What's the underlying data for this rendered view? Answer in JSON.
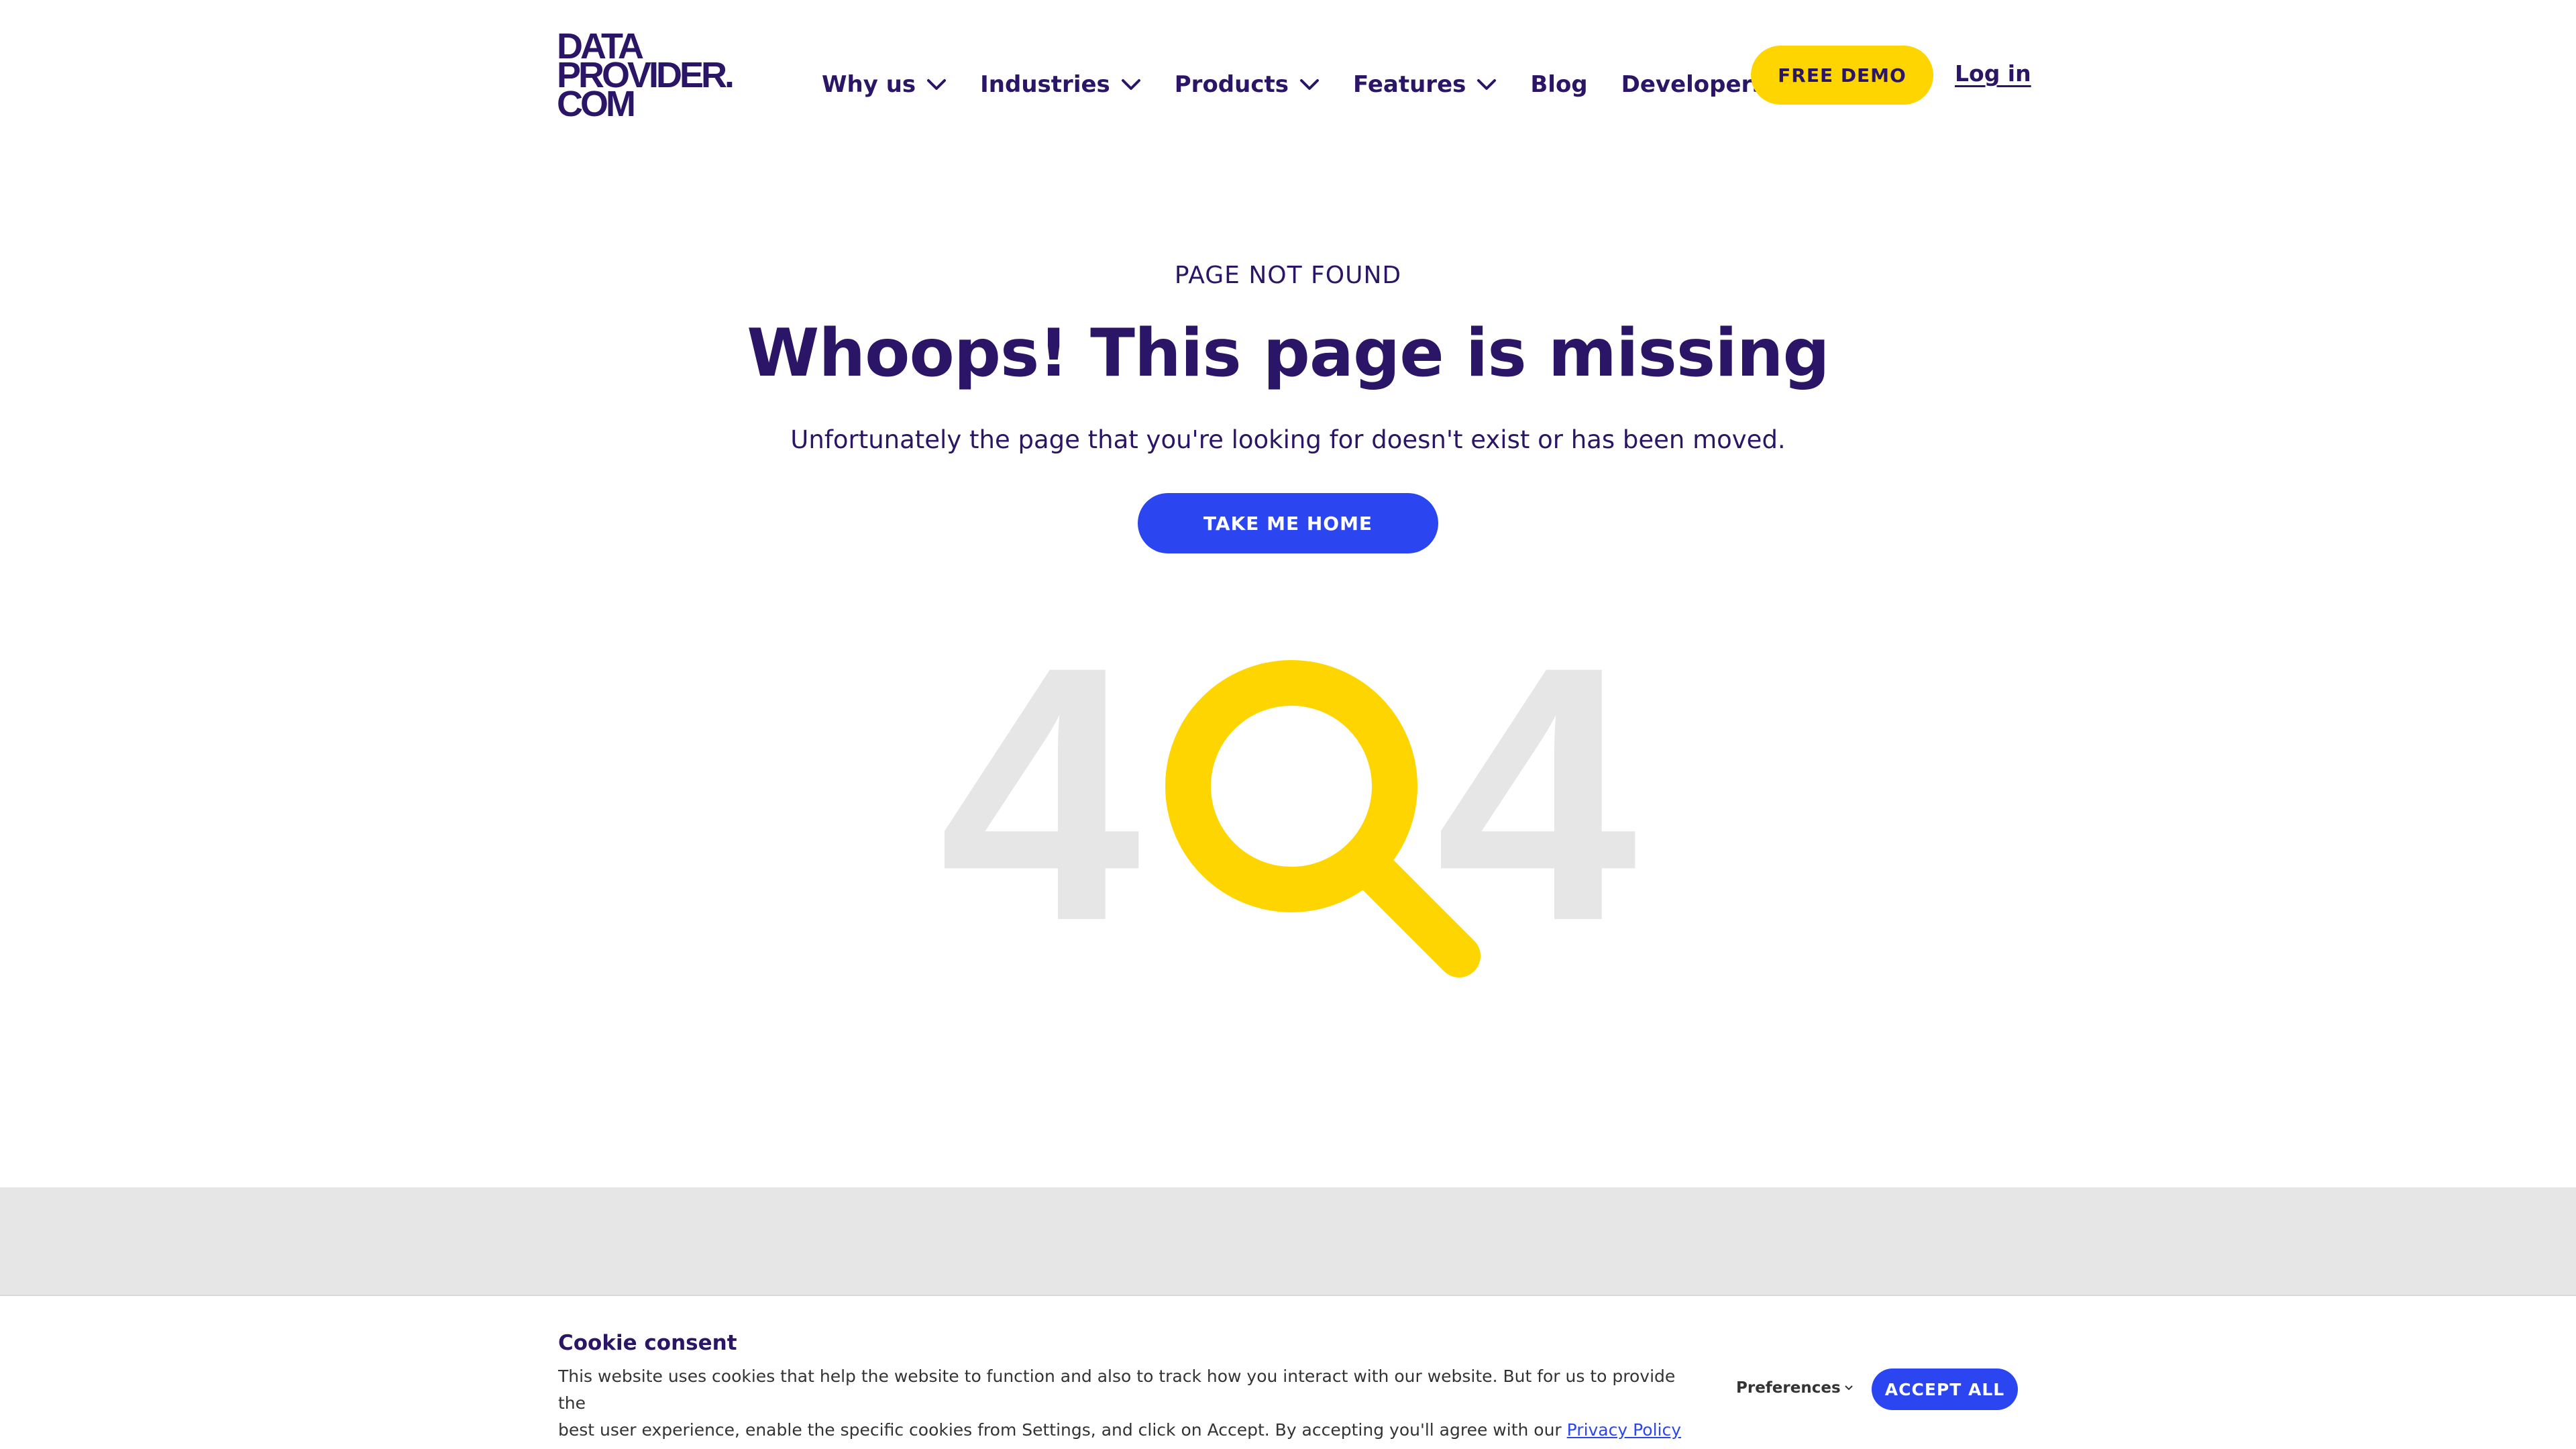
{
  "header": {
    "logo_lines": [
      "DATA",
      "PROVIDER.",
      "COM"
    ],
    "nav": [
      {
        "label": "Why us",
        "has_dropdown": true
      },
      {
        "label": "Industries",
        "has_dropdown": true
      },
      {
        "label": "Products",
        "has_dropdown": true
      },
      {
        "label": "Features",
        "has_dropdown": true
      },
      {
        "label": "Blog",
        "has_dropdown": false
      },
      {
        "label": "Developers",
        "has_dropdown": true
      }
    ],
    "demo_button": "FREE DEMO",
    "login_link": "Log in"
  },
  "main": {
    "eyebrow": "PAGE NOT FOUND",
    "headline": "Whoops! This page is missing",
    "subtext": "Unfortunately the page that you're looking for doesn't exist or has been moved.",
    "home_button": "TAKE ME HOME",
    "illustration": {
      "left_digit": "4",
      "right_digit": "4",
      "icon": "magnifier-icon"
    }
  },
  "cookie": {
    "title": "Cookie consent",
    "text_line1": "This website uses cookies that help the website to function and also to track how you interact with our website. But for us to provide the",
    "text_line2": "best user experience, enable the specific cookies from Settings, and click on Accept. By accepting you'll agree with our",
    "privacy_link": "Privacy Policy",
    "preferences": "Preferences",
    "accept_button": "ACCEPT ALL"
  },
  "colors": {
    "brand_navy": "#2a1566",
    "accent_yellow": "#ffd500",
    "primary_blue": "#2b46f0",
    "muted_gray": "#e6e6e6"
  }
}
